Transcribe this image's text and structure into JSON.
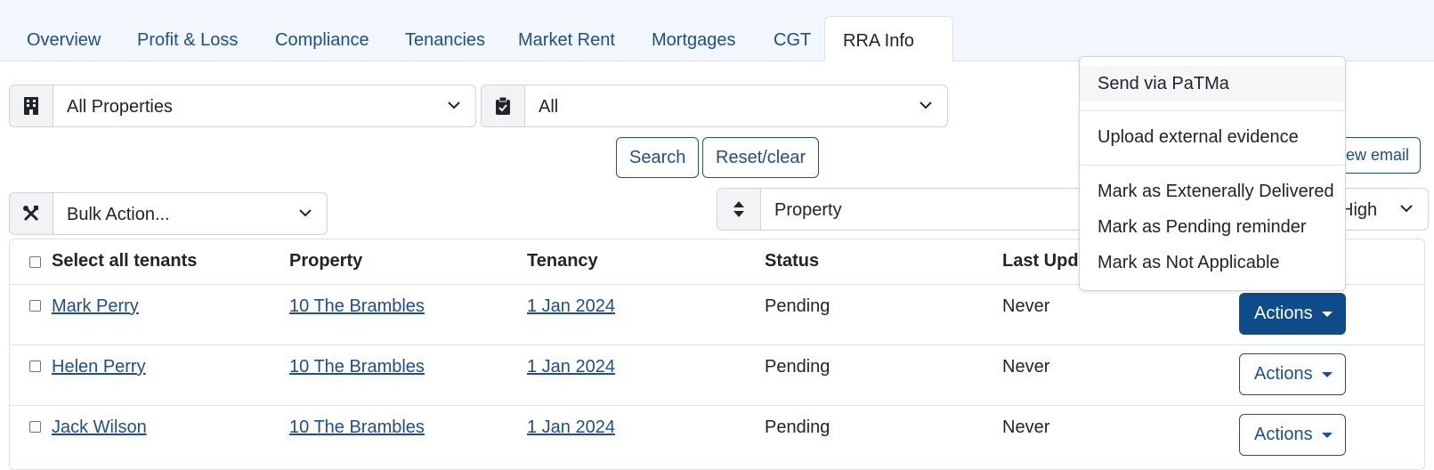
{
  "tabs": [
    {
      "label": "Overview",
      "active": false
    },
    {
      "label": "Profit & Loss",
      "active": false
    },
    {
      "label": "Compliance",
      "active": false
    },
    {
      "label": "Tenancies",
      "active": false
    },
    {
      "label": "Market Rent",
      "active": false
    },
    {
      "label": "Mortgages",
      "active": false
    },
    {
      "label": "CGT",
      "active": false
    },
    {
      "label": "RRA Info",
      "active": true
    }
  ],
  "filters": {
    "property": {
      "value": "All Properties",
      "icon": "building-icon"
    },
    "status": {
      "value": "All",
      "icon": "clipboard-check-icon"
    },
    "search_label": "Search",
    "reset_label": "Reset/clear"
  },
  "bulk_action": {
    "value": "Bulk Action...",
    "icon": "tools-icon"
  },
  "sort": {
    "field": "Property",
    "direction_partial": "High",
    "icon": "sort-icon"
  },
  "preview_email_partial": "view email",
  "table": {
    "headers": {
      "select_all": "Select all tenants",
      "property": "Property",
      "tenancy": "Tenancy",
      "status": "Status",
      "last_updated_partial": "Last Upda"
    },
    "rows": [
      {
        "tenant": "Mark Perry",
        "property": "10 The Brambles",
        "tenancy": "1 Jan 2024",
        "status": "Pending",
        "last_updated": "Never",
        "action": "Actions"
      },
      {
        "tenant": "Helen Perry",
        "property": "10 The Brambles",
        "tenancy": "1 Jan 2024",
        "status": "Pending",
        "last_updated": "Never",
        "action": "Actions"
      },
      {
        "tenant": "Jack Wilson",
        "property": "10 The Brambles",
        "tenancy": "1 Jan 2024",
        "status": "Pending",
        "last_updated": "Never",
        "action": "Actions"
      }
    ]
  },
  "actions_menu": {
    "items": [
      "Send via PaTMa",
      "Upload external evidence",
      "Mark as Extenerally Delivered",
      "Mark as Pending reminder",
      "Mark as Not Applicable"
    ]
  },
  "colors": {
    "link": "#1f4e8c",
    "primary_button": "#0f4c8a",
    "tabbar_bg": "#f1f7fc"
  }
}
